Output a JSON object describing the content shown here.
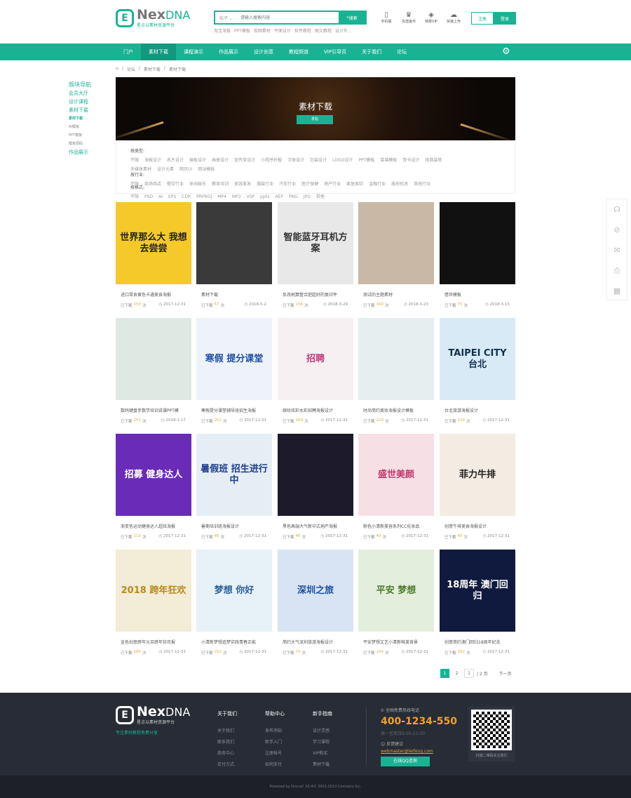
{
  "header": {
    "logo_mark": "E",
    "logo_name": "Nex",
    "logo_name2": "DNA",
    "logo_sub": "星点以素材资源平台",
    "search_category": "帖子 ⌄",
    "search_placeholder": "请输入搜索内容",
    "search_button": "搜索",
    "hot_words": [
      "淘宝海报",
      "PPT模板",
      "视频素材",
      "平面设计",
      "软件教程",
      "图文教程",
      "设计外..."
    ],
    "tools": [
      {
        "icon": "mobile-icon",
        "glyph": "▯",
        "label": "手机版"
      },
      {
        "icon": "crown-icon",
        "glyph": "♛",
        "label": "充值金币"
      },
      {
        "icon": "diamond-icon",
        "glyph": "◈",
        "label": "特惠VIP"
      },
      {
        "icon": "upload-icon",
        "glyph": "☁",
        "label": "快速上传"
      }
    ],
    "register": "注册",
    "login": "登录"
  },
  "nav": {
    "items": [
      "门户",
      "素材下载",
      "课程演示",
      "作品展示",
      "设计创意",
      "教程频道",
      "VIP引导页",
      "关于我们",
      "论坛"
    ],
    "active": 1,
    "gear": "⚙"
  },
  "breadcrumb": [
    "⌂",
    "论坛",
    "素材下载",
    "素材下载"
  ],
  "sidebar": {
    "title": "版块导航",
    "items": [
      {
        "label": "会员大厅",
        "t": "m"
      },
      {
        "label": "设计课程",
        "t": "m"
      },
      {
        "label": "素材下载",
        "t": "m"
      },
      {
        "label": "素材下载",
        "t": "a"
      },
      {
        "label": "AI模板",
        "t": "s"
      },
      {
        "label": "PPT模板",
        "t": "s"
      },
      {
        "label": "模板源码",
        "t": "s"
      },
      {
        "label": "作品展示",
        "t": "m"
      }
    ]
  },
  "banner": {
    "title": "素材下载",
    "button": "发帖"
  },
  "filters": [
    {
      "label": "按类型:",
      "options": [
        "不限",
        "海报设计",
        "名片设计",
        "展板设计",
        "画册设计",
        "宣传单设计",
        "小程序抄报",
        "字体设计",
        "包装设计",
        "LOGO设计",
        "PPT模板",
        "菜谱模板",
        "贺卡设计",
        "电商装修",
        "多媒体素材",
        "设计元素",
        "网页UI",
        "网站模板"
      ]
    },
    {
      "label": "按行业:",
      "options": [
        "不限",
        "商场商店",
        "餐饮行业",
        "休闲娱乐",
        "教育培训",
        "美容美发",
        "服装行业",
        "汽车行业",
        "医疗保健",
        "地产行业",
        "家居家纺",
        "金融行业",
        "政府机关",
        "其他行业"
      ]
    },
    {
      "label": "按格式:",
      "options": [
        "不限",
        "PSD",
        "AI",
        "EPS",
        "CDR",
        "PRPROJ",
        "MP4",
        "MP3",
        "VSP",
        "pptx",
        "AEP",
        "PNG",
        "JPG",
        "其他"
      ]
    }
  ],
  "cards": [
    {
      "title": "进口零食黄色卡通美食海报",
      "count": "150",
      "date": "2017-12-31",
      "img": "世界那么大 我想去尝尝",
      "bg": "#f5c92a",
      "fg": "#222"
    },
    {
      "title": "素材下载",
      "count": "67",
      "date": "2018-5-2",
      "img": "",
      "bg": "#3a3a3a",
      "fg": "#ccc"
    },
    {
      "title": "反改刷算整合肥超好的复印件",
      "count": "156",
      "date": "2018-3-29",
      "img": "智能蓝牙耳机方案",
      "bg": "#e8e8e8",
      "fg": "#333"
    },
    {
      "title": "测试的主题素材",
      "count": "160",
      "date": "2018-3-23",
      "img": "",
      "bg": "#c9b8a6",
      "fg": "#333"
    },
    {
      "title": "借世模板",
      "count": "75",
      "date": "2018-3-15",
      "img": "",
      "bg": "#111",
      "fg": "#444"
    },
    {
      "title": "数码键盘手数学培训说课PPT模",
      "count": "251",
      "date": "2018-1-17",
      "img": "",
      "bg": "#dfe9e4",
      "fg": "#333"
    },
    {
      "title": "寒假提分课堂辅导班招生海报",
      "count": "202",
      "date": "2017-12-31",
      "img": "寒假 提分课堂",
      "bg": "#eef3fb",
      "fg": "#1d4ea8"
    },
    {
      "title": "缤纷炫彩水彩招聘海报设计",
      "count": "263",
      "date": "2017-12-31",
      "img": "招聘",
      "bg": "#f6f0f2",
      "fg": "#c53a7e"
    },
    {
      "title": "时尚简约美妆海报设计模板",
      "count": "220",
      "date": "2017-12-31",
      "img": "",
      "bg": "#e7eef0",
      "fg": "#b0263a"
    },
    {
      "title": "台北旅游海报设计",
      "count": "109",
      "date": "2017-12-31",
      "img": "TAIPEI CITY 台北",
      "bg": "#d8eaf5",
      "fg": "#14304f"
    },
    {
      "title": "渐变色运动健身达人超炫海报",
      "count": "113",
      "date": "2017-12-31",
      "img": "招募 健身达人",
      "bg": "#6a2bb8",
      "fg": "#fff"
    },
    {
      "title": "暑期培训班海报设计",
      "count": "46",
      "date": "2017-12-31",
      "img": "暑假班 招生进行中",
      "bg": "#e6eef5",
      "fg": "#1e3c8a"
    },
    {
      "title": "黑色高端大气新中式地产海报",
      "count": "46",
      "date": "2017-12-31",
      "img": "",
      "bg": "#1d1a2c",
      "fg": "#d4a85a"
    },
    {
      "title": "粉色小清新美容系列CC化妆品",
      "count": "49",
      "date": "2017-12-31",
      "img": "盛世美颜",
      "bg": "#f7dfe6",
      "fg": "#c2376d"
    },
    {
      "title": "创意牛排美食海报设计",
      "count": "40",
      "date": "2017-12-31",
      "img": "菲力牛排",
      "bg": "#f2ece2",
      "fg": "#222"
    },
    {
      "title": "金色创意跨年元旦跨年狂欢报",
      "count": "265",
      "date": "2017-12-31",
      "img": "2018 跨年狂欢",
      "bg": "#f3ecd6",
      "fg": "#b88a1e"
    },
    {
      "title": "小清新梦想追梦实践青春正能",
      "count": "252",
      "date": "2017-12-31",
      "img": "梦想 你好",
      "bg": "#e6f1f8",
      "fg": "#2b5e96"
    },
    {
      "title": "简约大气深圳旅游海报设计",
      "count": "70",
      "date": "2017-12-31",
      "img": "深圳之旅",
      "bg": "#d8e4f3",
      "fg": "#1d4fa0"
    },
    {
      "title": "平安梦想文艺小清新唯美背景",
      "count": "104",
      "date": "2017-12-31",
      "img": "平安 梦想",
      "bg": "#e4eedc",
      "fg": "#4b7a2a"
    },
    {
      "title": "创意简约澳门回归18周年纪念",
      "count": "382",
      "date": "2017-12-31",
      "img": "18周年 澳门回归",
      "bg": "#0f1a3e",
      "fg": "#fff"
    }
  ],
  "card_labels": {
    "downloaded": "已下载",
    "times": "次"
  },
  "pagination": {
    "pages": [
      "1",
      "2"
    ],
    "current": "1",
    "input": "1",
    "total": "/ 2 页",
    "next": "下一页"
  },
  "right_bar": [
    {
      "icon": "headset-icon",
      "glyph": "☊"
    },
    {
      "icon": "compass-icon",
      "glyph": "⊘"
    },
    {
      "icon": "mail-icon",
      "glyph": "✉"
    },
    {
      "icon": "print-icon",
      "glyph": "⎙"
    },
    {
      "icon": "qrcode-icon",
      "glyph": "▦"
    }
  ],
  "footer": {
    "slogan": "专注素材教程免费分享",
    "cols": [
      {
        "title": "关于我们",
        "links": [
          "关于我们",
          "联系我们",
          "商务中心",
          "支付方式"
        ]
      },
      {
        "title": "帮助中心",
        "links": [
          "发布须知",
          "新手入门",
          "注册帐号",
          "如何支付"
        ]
      },
      {
        "title": "新手指南",
        "links": [
          "设计灵感",
          "学习课程",
          "VIP购买",
          "素材下载"
        ]
      }
    ],
    "hotline_label": "全国免费热线电话",
    "phone": "400-1234-550",
    "hours": "周一至周日9:00-23:00",
    "feedback": "反馈建议",
    "email": "webmaster@leifeng.com",
    "qq_button": "在线QQ咨询",
    "qr_caption": "扫描二维码关注我们"
  },
  "copyright": "Powered by Discuz! X3.4© 2001-2013 Comsenz Inc."
}
